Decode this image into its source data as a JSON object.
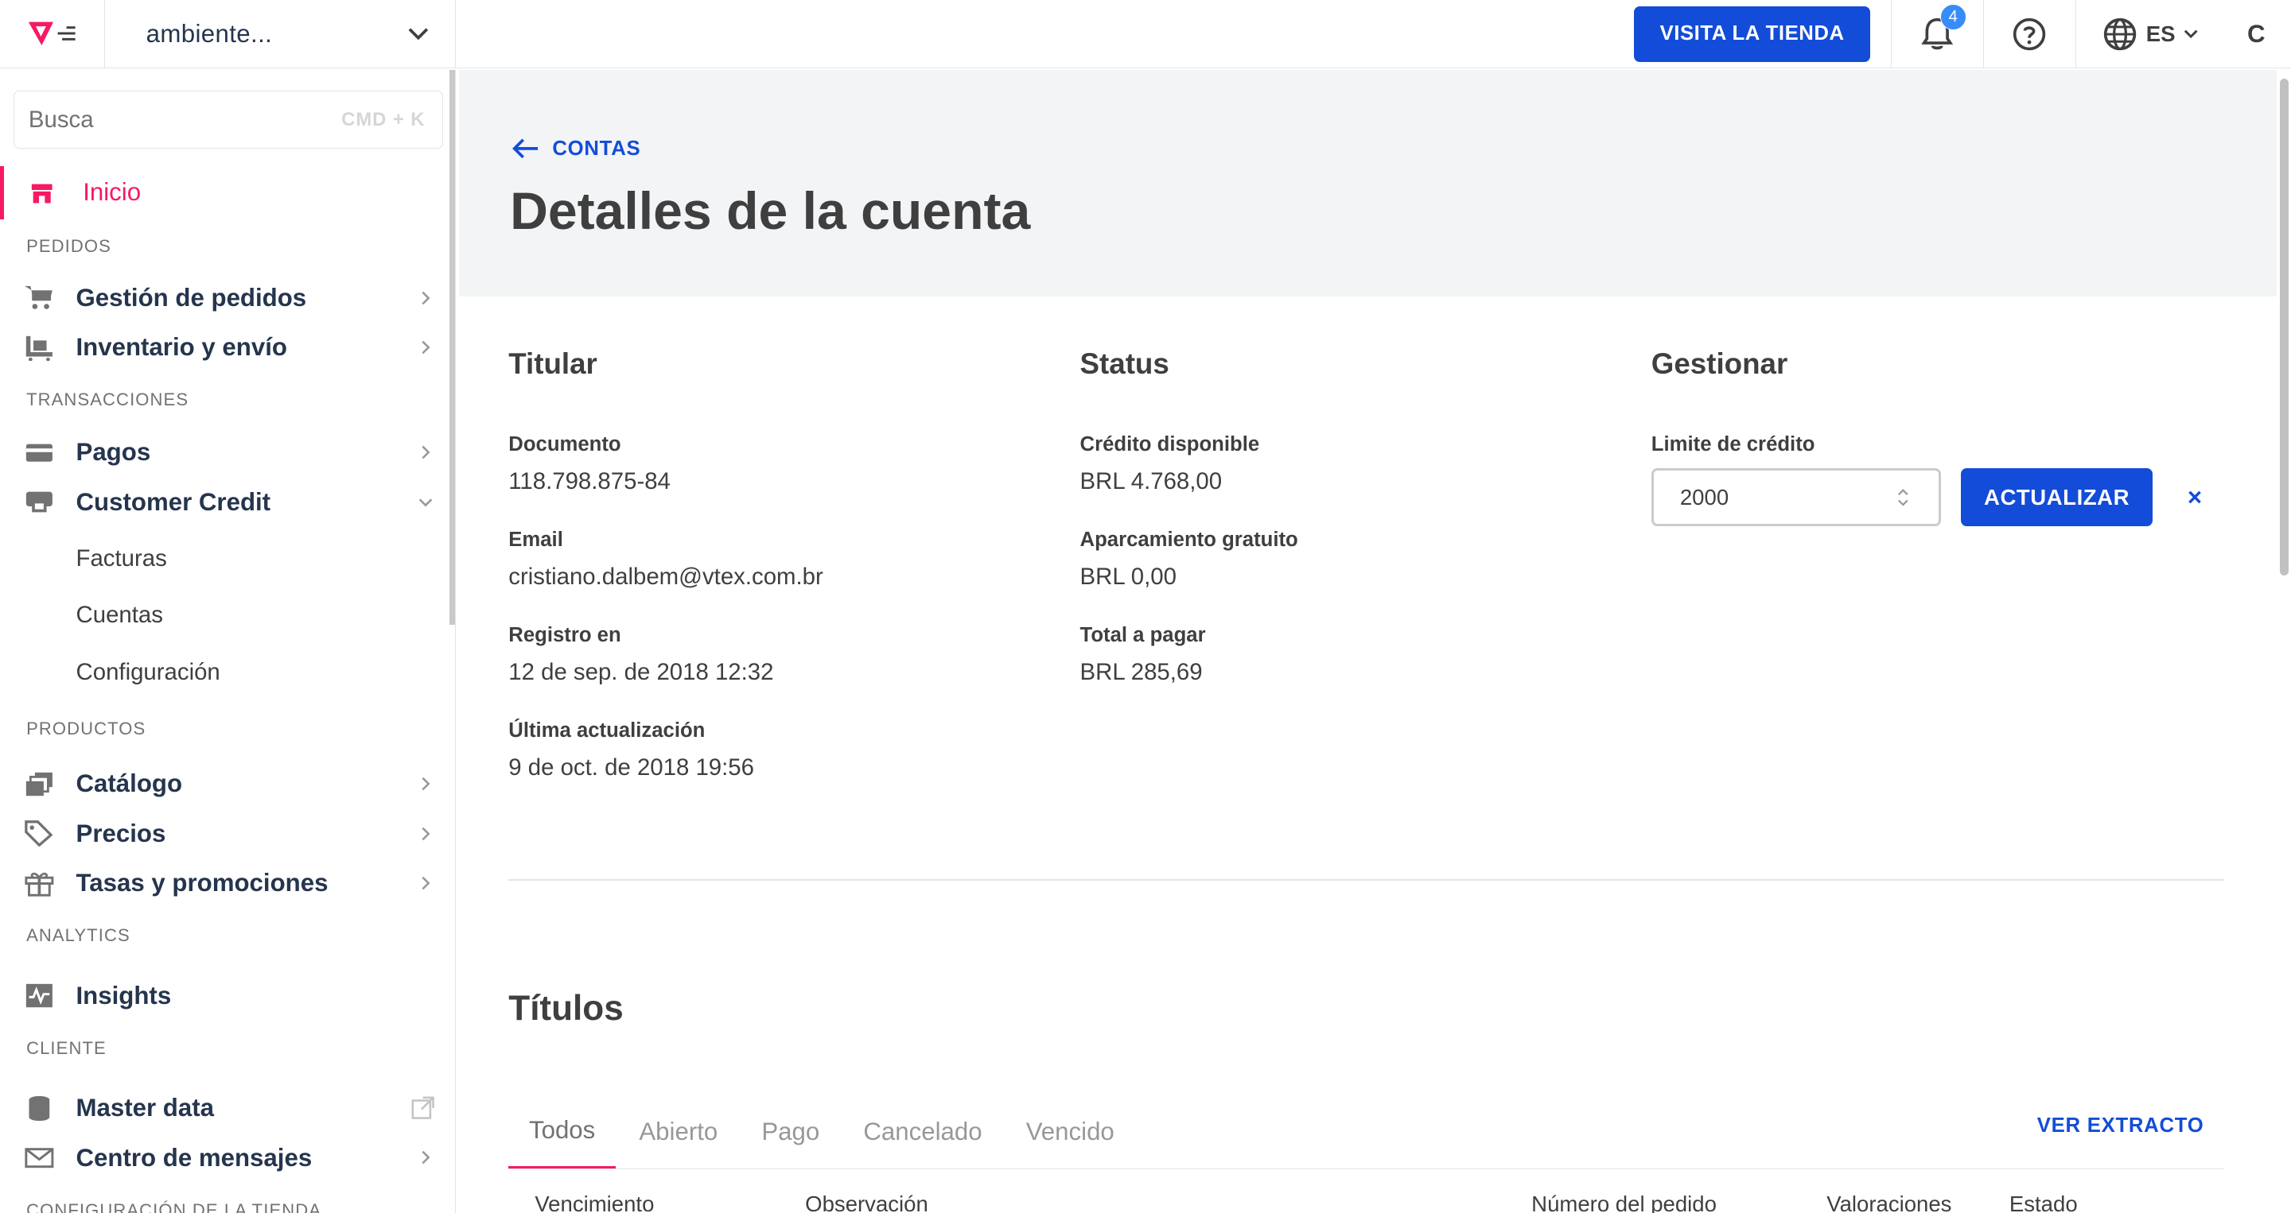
{
  "topbar": {
    "account_name": "ambiente...",
    "visit_store_label": "VISITA LA TIENDA",
    "notification_count": "4",
    "language": "ES",
    "user_initial": "C"
  },
  "sidebar": {
    "search_placeholder": "Busca",
    "search_shortcut": "CMD + K",
    "home_label": "Inicio",
    "sections": {
      "orders": "PEDIDOS",
      "transactions": "TRANSACCIONES",
      "products": "PRODUCTOS",
      "analytics": "ANALYTICS",
      "customer": "CLIENTE",
      "store_settings": "CONFIGURACIÓN DE LA TIENDA"
    },
    "items": {
      "order_management": "Gestión de pedidos",
      "inventory_shipping": "Inventario y envío",
      "payments": "Pagos",
      "customer_credit": "Customer Credit",
      "invoices": "Facturas",
      "accounts": "Cuentas",
      "settings": "Configuración",
      "catalog": "Catálogo",
      "prices": "Precios",
      "promotions": "Tasas y promociones",
      "insights": "Insights",
      "master_data": "Master data",
      "message_center": "Centro de mensajes"
    }
  },
  "header": {
    "back_label": "CONTAS",
    "title": "Detalles de la cuenta"
  },
  "holder": {
    "title": "Titular",
    "document_label": "Documento",
    "document_value": "118.798.875-84",
    "email_label": "Email",
    "email_value": "cristiano.dalbem@vtex.com.br",
    "registered_label": "Registro en",
    "registered_value": "12 de sep. de 2018 12:32",
    "updated_label": "Última actualización",
    "updated_value": "9 de oct. de 2018 19:56"
  },
  "status": {
    "title": "Status",
    "available_label": "Crédito disponible",
    "available_value": "BRL 4.768,00",
    "free_parking_label": "Aparcamiento gratuito",
    "free_parking_value": "BRL 0,00",
    "total_label": "Total a pagar",
    "total_value": "BRL 285,69"
  },
  "manage": {
    "title": "Gestionar",
    "credit_limit_label": "Limite de crédito",
    "credit_limit_value": "2000",
    "update_label": "ACTUALIZAR",
    "close_label": "×"
  },
  "titles": {
    "title": "Títulos",
    "tabs": [
      "Todos",
      "Abierto",
      "Pago",
      "Cancelado",
      "Vencido"
    ],
    "extract_label": "VER EXTRACTO",
    "columns": [
      "Vencimiento",
      "Observación",
      "Número del pedido",
      "Valoraciones",
      "Estado"
    ]
  },
  "colors": {
    "accent": "#f71963",
    "primary": "#134cd8",
    "header_bg": "#f2f4f5"
  }
}
